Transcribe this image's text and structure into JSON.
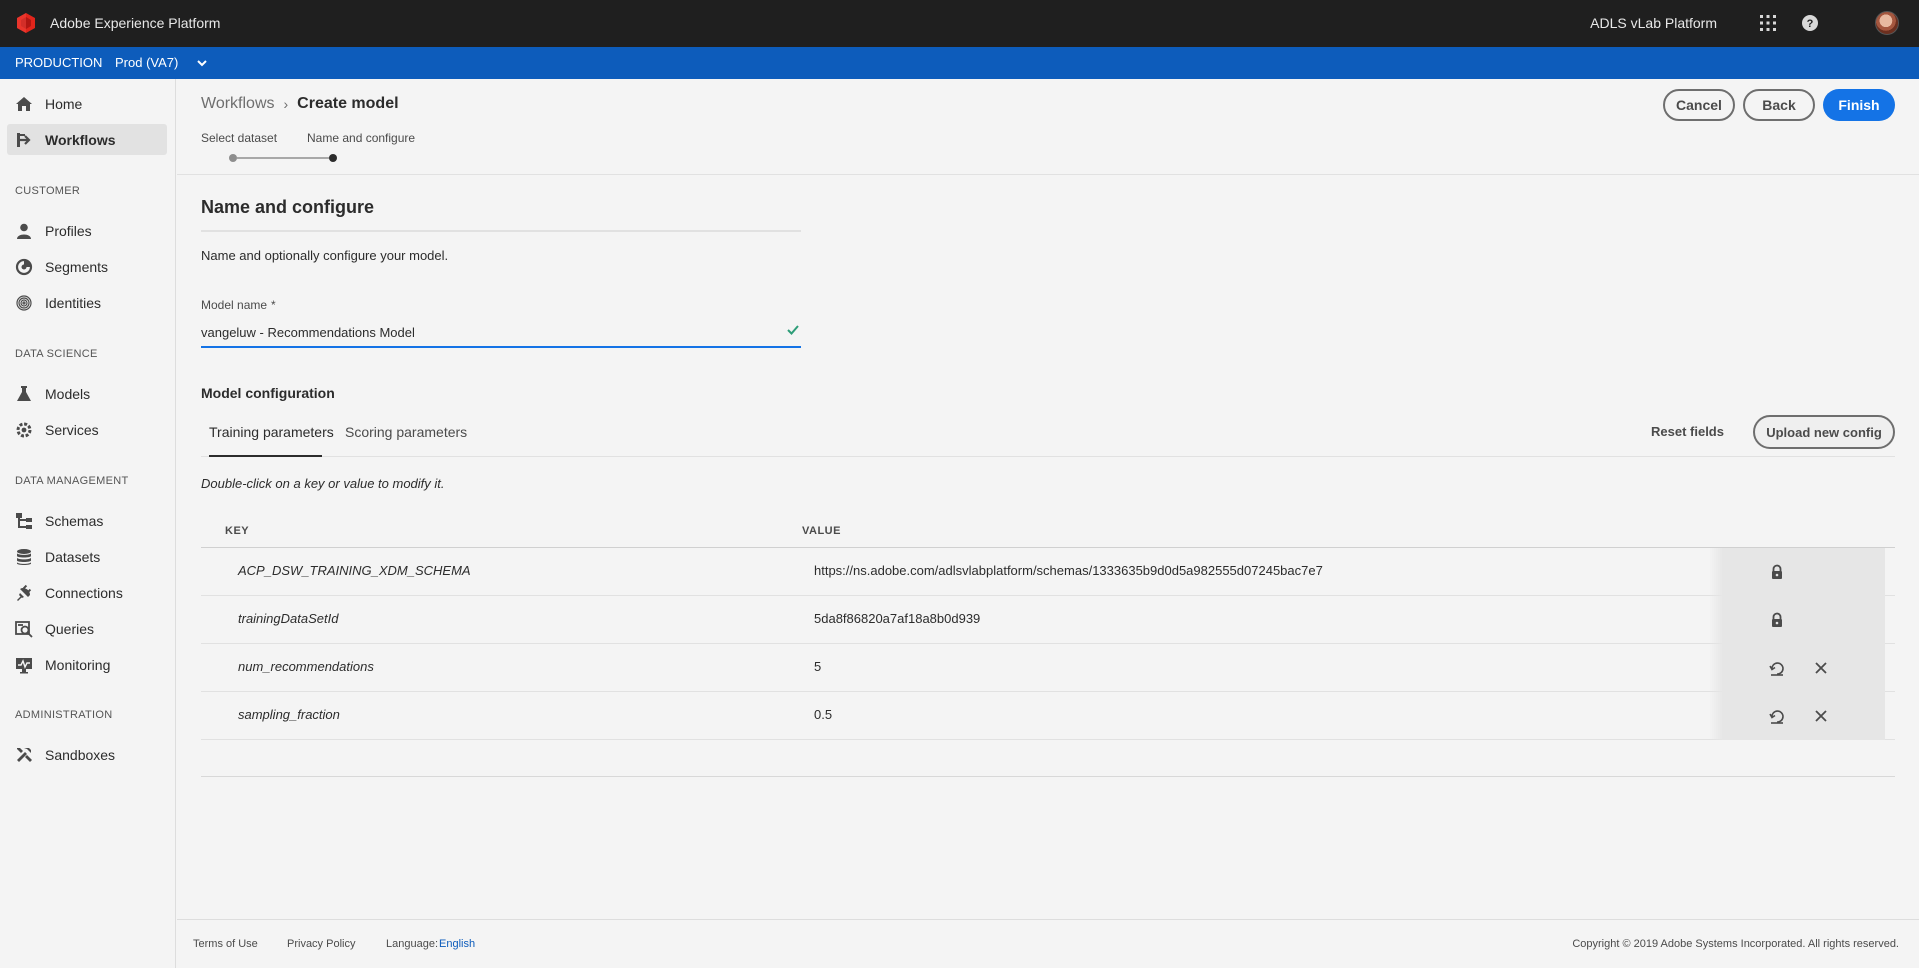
{
  "header": {
    "app_title": "Adobe Experience Platform",
    "org_name": "ADLS vLab Platform",
    "icons": [
      "adobe-logo-icon",
      "apps-grid-icon",
      "help-icon",
      "avatar"
    ]
  },
  "environment": {
    "env_label": "PRODUCTION",
    "sandbox_label": "Prod (VA7)"
  },
  "sidebar": {
    "items": [
      {
        "label": "Home",
        "icon": "home-icon"
      },
      {
        "label": "Workflows",
        "icon": "workflows-icon"
      },
      {
        "label": "Profiles",
        "icon": "person-icon"
      },
      {
        "label": "Segments",
        "icon": "segments-icon"
      },
      {
        "label": "Identities",
        "icon": "fingerprint-icon"
      },
      {
        "label": "Models",
        "icon": "flask-icon"
      },
      {
        "label": "Services",
        "icon": "gear-icon"
      },
      {
        "label": "Schemas",
        "icon": "schema-icon"
      },
      {
        "label": "Datasets",
        "icon": "database-icon"
      },
      {
        "label": "Connections",
        "icon": "plug-icon"
      },
      {
        "label": "Queries",
        "icon": "query-icon"
      },
      {
        "label": "Monitoring",
        "icon": "monitor-icon"
      },
      {
        "label": "Sandboxes",
        "icon": "tools-icon"
      }
    ],
    "sections": [
      "CUSTOMER",
      "DATA SCIENCE",
      "DATA MANAGEMENT",
      "ADMINISTRATION"
    ]
  },
  "breadcrumb": {
    "parent": "Workflows",
    "current": "Create model"
  },
  "actions": {
    "cancel": "Cancel",
    "back": "Back",
    "finish": "Finish"
  },
  "stepper": {
    "steps": [
      "Select dataset",
      "Name and configure"
    ]
  },
  "form": {
    "title": "Name and configure",
    "description": "Name and optionally configure your model.",
    "model_name_label": "Model name",
    "required_mark": "*",
    "model_name_value": "vangeluw - Recommendations Model",
    "config_title": "Model configuration",
    "tabs": [
      "Training parameters",
      "Scoring parameters"
    ],
    "reset_label": "Reset fields",
    "upload_label": "Upload new config",
    "hint": "Double-click on a key or value to modify it."
  },
  "table": {
    "columns": [
      "KEY",
      "VALUE"
    ],
    "rows": [
      {
        "key": "ACP_DSW_TRAINING_XDM_SCHEMA",
        "value": "https://ns.adobe.com/adlsvlabplatform/schemas/1333635b9d0d5a982555d07245bac7e7",
        "locked": true
      },
      {
        "key": "trainingDataSetId",
        "value": "5da8f86820a7af18a8b0d939",
        "locked": true
      },
      {
        "key": "num_recommendations",
        "value": "5",
        "locked": false
      },
      {
        "key": "sampling_fraction",
        "value": "0.5",
        "locked": false
      }
    ]
  },
  "footer": {
    "terms": "Terms of Use",
    "privacy": "Privacy Policy",
    "language_label": "Language:",
    "language_value": "English",
    "copyright": "Copyright © 2019 Adobe Systems Incorporated. All rights reserved."
  }
}
